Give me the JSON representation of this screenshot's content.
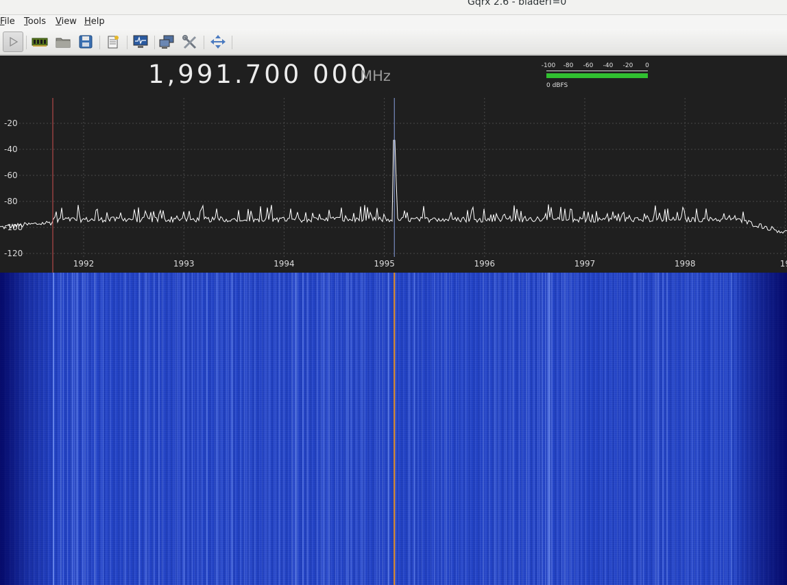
{
  "window": {
    "title": "Gqrx 2.6 - bladerf=0"
  },
  "menu": [
    {
      "label": "File",
      "mnemonic": "F",
      "rest": "ile"
    },
    {
      "label": "Tools",
      "mnemonic": "T",
      "rest": "ools"
    },
    {
      "label": "View",
      "mnemonic": "V",
      "rest": "iew"
    },
    {
      "label": "Help",
      "mnemonic": "H",
      "rest": "elp"
    }
  ],
  "toolbar": {
    "icons": [
      "play-icon",
      "hardware-card-icon",
      "open-folder-icon",
      "save-icon",
      "notes-icon",
      "monitor-icon",
      "network-icon",
      "tools-icon",
      "move-icon"
    ]
  },
  "frequency": {
    "value": "1,991.700 000",
    "unit": "MHz"
  },
  "meter": {
    "ticks": [
      "-100",
      "-80",
      "-60",
      "-40",
      "-20",
      "0"
    ],
    "label": "0 dBFS",
    "bar_color": "#30c030"
  },
  "chart_data": {
    "type": "line",
    "y_ticks": [
      "-20",
      "-40",
      "-60",
      "-80",
      "-100",
      "-120"
    ],
    "x_ticks": [
      "1992",
      "1993",
      "1994",
      "1995",
      "1996",
      "1997",
      "1998",
      "19"
    ],
    "x_range_mhz": [
      1991.7,
      1999.5
    ],
    "y_range_db": [
      -130,
      -10
    ],
    "noise_floor_db": -94,
    "peak": {
      "freq_mhz": 1995.1,
      "level_db": -33
    },
    "lower_cursor_mhz": 1991.75,
    "colors": {
      "trace": "#ffffff",
      "grid": "#4a4a4a",
      "cursor_left": "#d05050",
      "cursor_center": "#8aa0e0",
      "waterfall_center": "#e08a20"
    }
  }
}
